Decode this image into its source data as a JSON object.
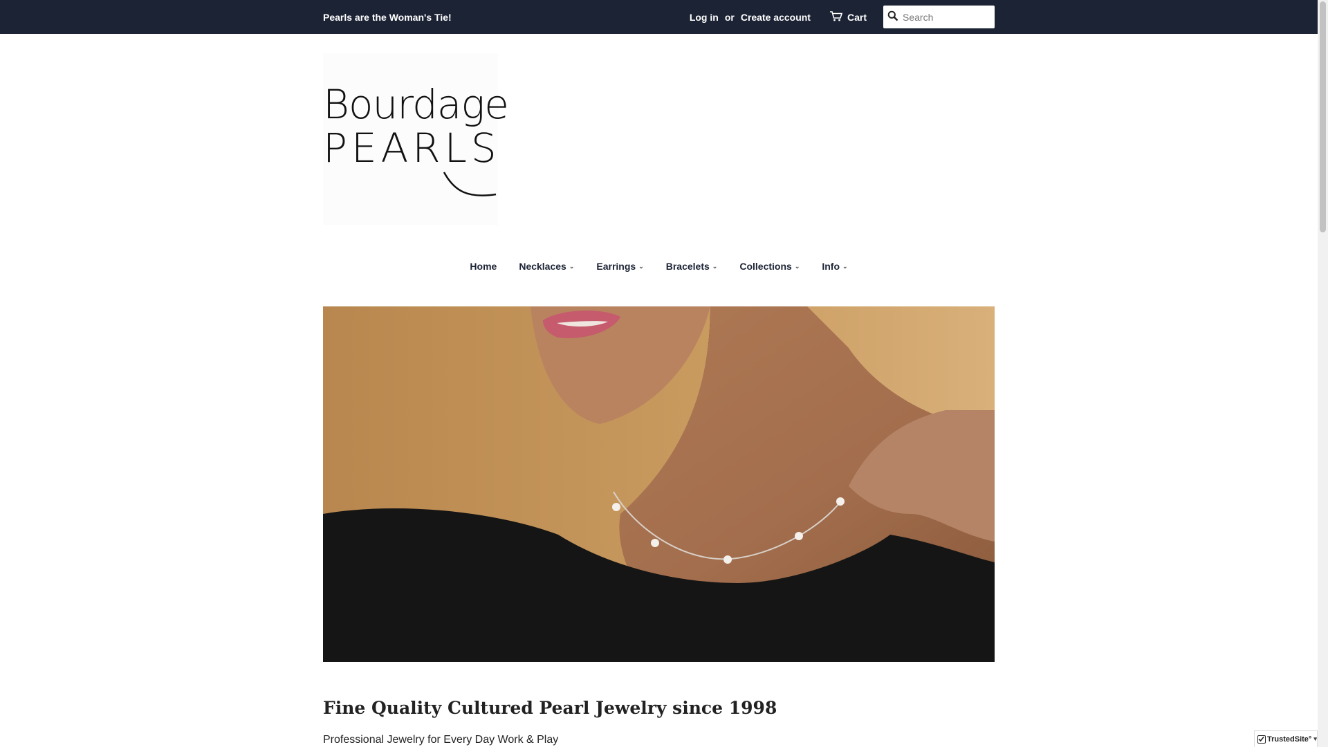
{
  "topbar": {
    "tagline": "Pearls are the Woman's Tie!",
    "login_label": "Log in",
    "or_label": "or",
    "create_account_label": "Create account",
    "cart_label": "Cart",
    "search_placeholder": "Search",
    "background_color": "#1c2335"
  },
  "logo": {
    "line1": "Bourdage",
    "line2": "PEARLS"
  },
  "nav": {
    "items": [
      {
        "label": "Home",
        "has_dropdown": false
      },
      {
        "label": "Necklaces",
        "has_dropdown": true
      },
      {
        "label": "Earrings",
        "has_dropdown": true
      },
      {
        "label": "Bracelets",
        "has_dropdown": true
      },
      {
        "label": "Collections",
        "has_dropdown": true
      },
      {
        "label": "Info",
        "has_dropdown": true
      }
    ],
    "dropdown_icon": "chevron-down-icon"
  },
  "main": {
    "headline": "Fine Quality Cultured Pearl Jewelry since 1998",
    "subline": "Professional Jewelry for Every Day Work & Play"
  },
  "badge": {
    "label": "TrustedSite",
    "trademark": "°"
  },
  "icons": {
    "search": "search-icon",
    "cart": "cart-icon"
  }
}
